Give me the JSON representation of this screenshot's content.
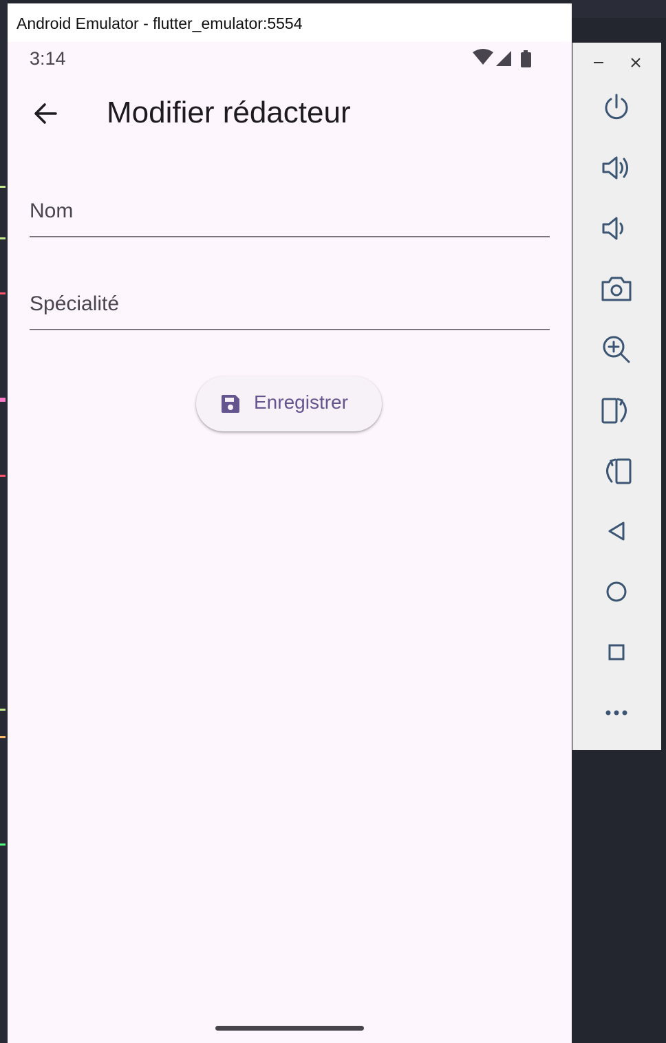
{
  "window": {
    "title": "Android Emulator - flutter_emulator:5554"
  },
  "status_bar": {
    "time": "3:14",
    "icons": [
      "wifi-icon",
      "signal-icon",
      "battery-icon"
    ]
  },
  "app_bar": {
    "back_icon": "arrow-back-icon",
    "title": "Modifier rédacteur"
  },
  "form": {
    "name_field": {
      "placeholder": "Nom",
      "value": ""
    },
    "specialty_field": {
      "placeholder": "Spécialité",
      "value": ""
    },
    "save_button": {
      "icon": "save-icon",
      "label": "Enregistrer"
    }
  },
  "emulator_toolbar": {
    "items": [
      "minimize-icon",
      "close-icon",
      "power-icon",
      "volume-up-icon",
      "volume-down-icon",
      "camera-icon",
      "zoom-icon",
      "rotate-right-icon",
      "rotate-left-icon",
      "back-icon",
      "home-icon",
      "overview-icon",
      "more-icon"
    ]
  },
  "colors": {
    "screen_background": "#fdf6fc",
    "accent": "#65558f",
    "text_primary": "#1d1b20",
    "text_secondary": "#49454f",
    "toolbar_background": "#efefef"
  }
}
